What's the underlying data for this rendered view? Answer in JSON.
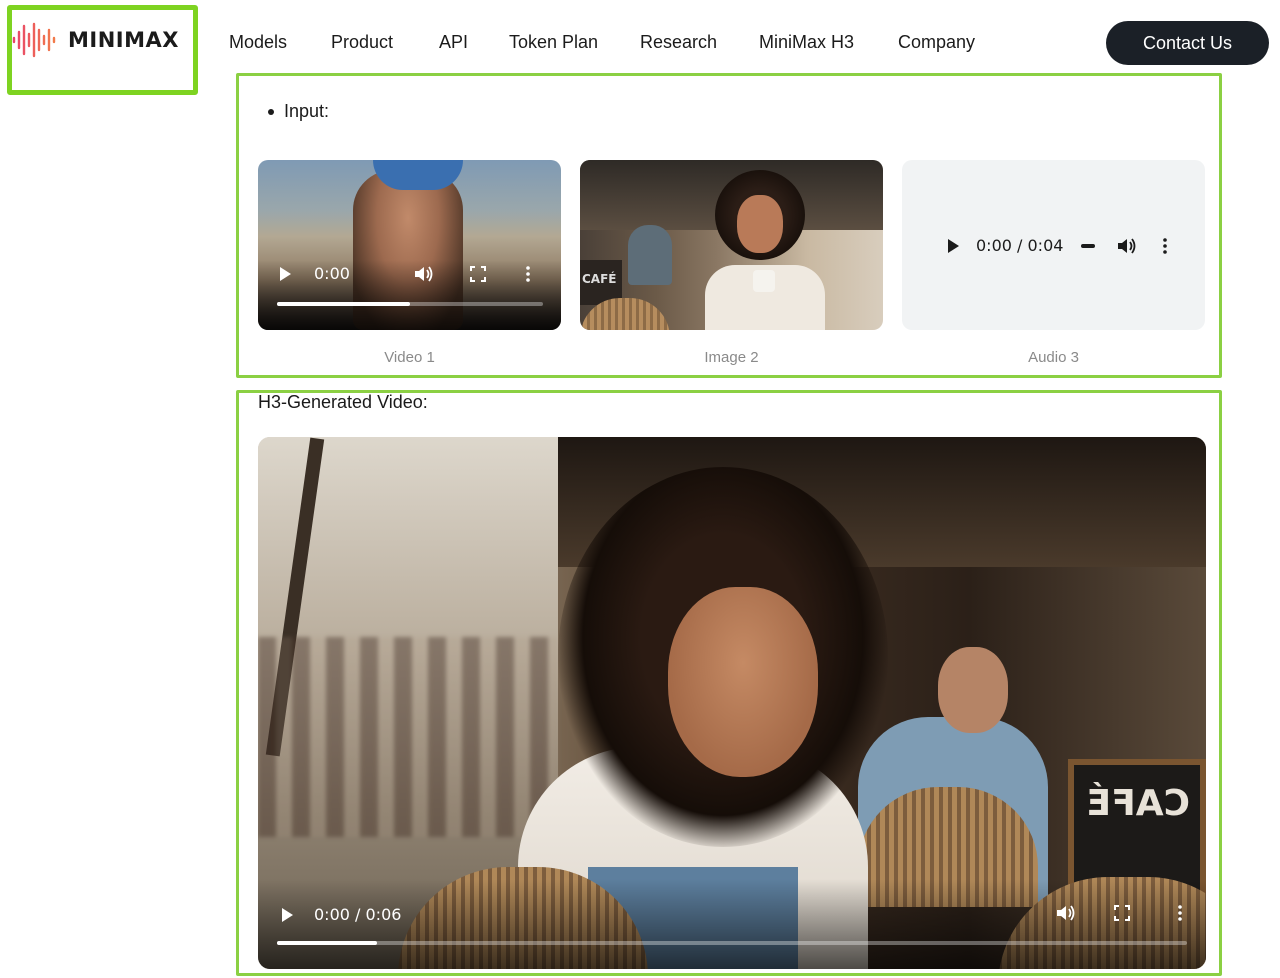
{
  "brand": {
    "logo_text": "MINIMAX",
    "accent": "#8bd043"
  },
  "nav": {
    "items": [
      "Models",
      "Product",
      "API",
      "Token Plan",
      "Research",
      "MiniMax H3",
      "Company"
    ],
    "contact_label": "Contact Us"
  },
  "input_section": {
    "label": "Input:",
    "media": [
      {
        "type": "video",
        "caption": "Video 1",
        "time": "0:00",
        "progress": 0.5
      },
      {
        "type": "image",
        "caption": "Image 2",
        "sign_text": "CAFÉ"
      },
      {
        "type": "audio",
        "caption": "Audio 3",
        "time": "0:00 / 0:04"
      }
    ]
  },
  "output_section": {
    "label": "H3-Generated Video:",
    "video": {
      "time": "0:00 / 0:06",
      "progress": 0.11,
      "sign_text": "CAFÉ"
    }
  }
}
